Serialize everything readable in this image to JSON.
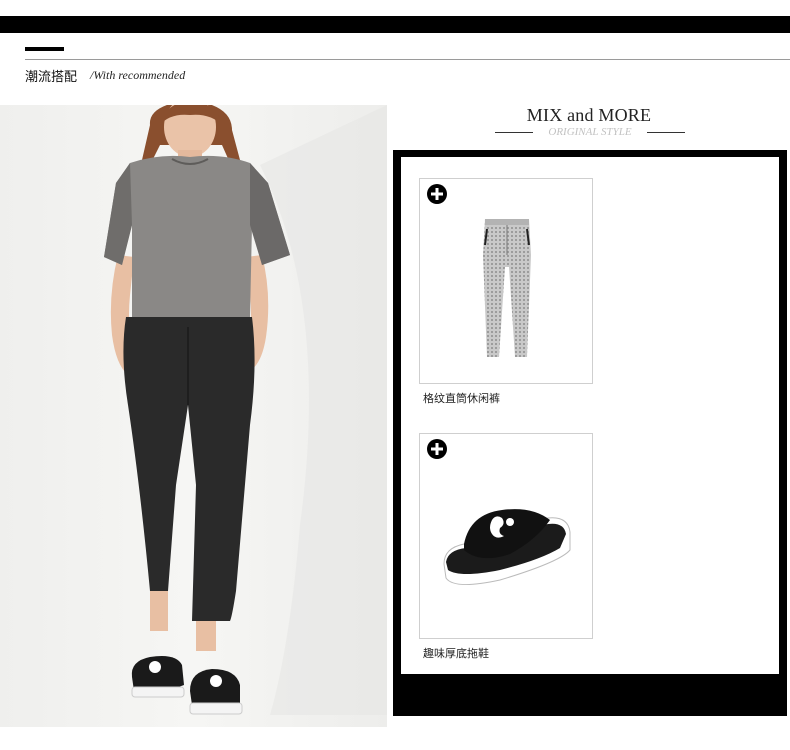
{
  "header": {
    "section_title": "潮流搭配",
    "section_subtitle": "/With recommended"
  },
  "mix_panel": {
    "title": "MIX and MORE",
    "subtitle": "ORIGINAL STYLE"
  },
  "products": [
    {
      "name": "格纹直筒休闲裤",
      "icon": "plus-circle-icon"
    },
    {
      "name": "趣味厚底拖鞋",
      "icon": "plus-circle-icon"
    }
  ],
  "colors": {
    "frame": "#000000",
    "sweater": "#8a8886",
    "pants": "#2a2a2a"
  }
}
